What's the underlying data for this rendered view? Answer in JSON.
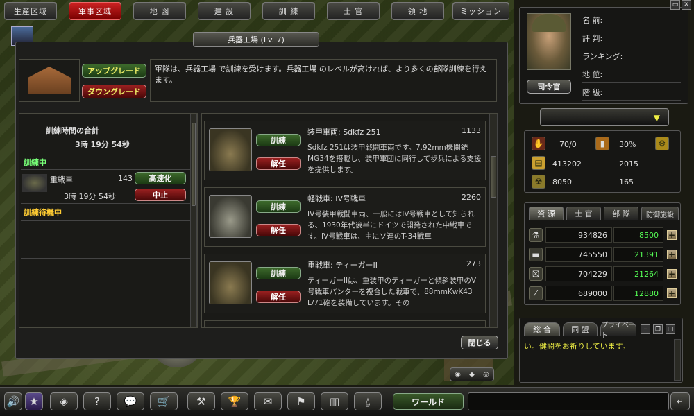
{
  "nav": [
    "生産区域",
    "軍事区域",
    "地 図",
    "建 設",
    "訓 練",
    "士 官",
    "領 地",
    "ミッション"
  ],
  "dialog": {
    "title": "兵器工場 (Lv. 7)",
    "upgrade": "アップグレード",
    "downgrade": "ダウングレード",
    "description": "軍隊は、兵器工場 で訓練を受けます。兵器工場 のレベルが高ければ、より多くの部隊訓練を行えます。",
    "close": "閉じる",
    "queue": {
      "total_label": "訓練時間の合計",
      "total_time": "3時 19分 54秒",
      "in_training_label": "訓練中",
      "item_name": "重戦車",
      "item_count": "143",
      "item_time": "3時 19分 54秒",
      "speedup": "高速化",
      "stop": "中止",
      "waiting_label": "訓練待機中"
    },
    "units": [
      {
        "name": "装甲車両: Sdkfz 251",
        "count": "1133",
        "train": "訓練",
        "dismiss": "解任",
        "desc": "Sdkfz 251は装甲戦闘車両です。7.92mm機関銃MG34を搭載し、装甲軍団に同行して歩兵による支援を提供します。"
      },
      {
        "name": "軽戦車: IV号戦車",
        "count": "2260",
        "train": "訓練",
        "dismiss": "解任",
        "desc": "IV号装甲戦闘車両、一般にはIV号戦車として知られる、1930年代後半にドイツで開発された中戦車です。IV号戦車は、主にソ連のT-34戦車"
      },
      {
        "name": "重戦車: ティーガーII",
        "count": "273",
        "train": "訓練",
        "dismiss": "解任",
        "desc": "ティーガーIIは、重装甲のティーガーと傾斜装甲のV号戦車パンターを複合した戦車で、88mmKwK43 L/71砲を装備しています。その"
      }
    ]
  },
  "profile": {
    "name_label": "名 前:",
    "reputation_label": "評 判:",
    "ranking_label": "ランキング:",
    "status_label": "地 位:",
    "rank_label": "階 級:",
    "commander_btn": "司令官"
  },
  "stats": {
    "troops": "70/0",
    "percent": "30%",
    "gold": "413202",
    "gold2": "2015",
    "food": "8050",
    "food2": "165"
  },
  "resource_tabs": [
    "資 源",
    "士 官",
    "部 隊",
    "防御施設"
  ],
  "resources": [
    {
      "amount": "934826",
      "rate": "8500"
    },
    {
      "amount": "745550",
      "rate": "21391"
    },
    {
      "amount": "704229",
      "rate": "21264"
    },
    {
      "amount": "689000",
      "rate": "12880"
    }
  ],
  "chat": {
    "tabs": [
      "総 合",
      "同 盟",
      "プライベート"
    ],
    "message": "い。健闘をお祈りしています。"
  },
  "world_btn": "ワールド",
  "colors": {
    "accent_red": "#c22222",
    "accent_green": "#3d6a2c",
    "value_green": "#55ff55"
  }
}
